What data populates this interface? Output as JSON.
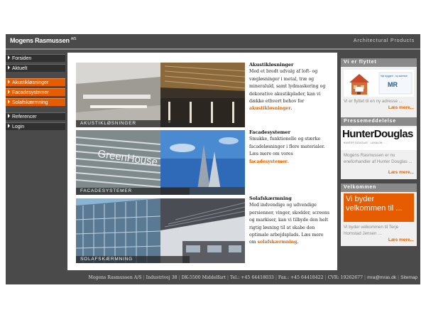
{
  "header": {
    "logo_text": "Mogens Rasmussen",
    "logo_suffix": "A/S",
    "tagline": "Architectural Products"
  },
  "nav": {
    "items": [
      {
        "label": "Forsiden",
        "style": "dark"
      },
      {
        "label": "Aktuelt",
        "style": "dark"
      },
      {
        "label": "Akustikløsninger",
        "style": "orange"
      },
      {
        "label": "Facadesystemer",
        "style": "orange"
      },
      {
        "label": "Solafskærmning",
        "style": "orange"
      },
      {
        "label": "Referencer",
        "style": "dark"
      },
      {
        "label": "Login",
        "style": "dark"
      }
    ]
  },
  "main": {
    "sections": [
      {
        "caption": "AKUSTIKLØSNINGER",
        "heading": "Akustikløsninger",
        "body": "Med et bredt udvalg af loft- og vægløsninger i metal, træ og mineraluld, samt lydmaskering og dekorative akustikplader, kan vi dække ethvert behov for",
        "link": "akustikløsninger",
        "suffix": "."
      },
      {
        "caption": "FACADESYSTEMER",
        "heading": "Facadesystemer",
        "body": "Smukke, funktionelle og stærke facadeløsninger i flere materialer.",
        "body2": "Læs mere om vores",
        "link": "facadesystemer",
        "suffix": "."
      },
      {
        "caption": "SOLAFSKÆRMNING",
        "heading": "Solafskærmning",
        "body": "Med indvendige og udvendige persienner, vinger, skodder, screens og markiser, kan vi tilbyde den helt rigtig løsning til at skabe den optimale arbejdsplads. Læs mere om",
        "link": "solafskærmning",
        "suffix": "."
      }
    ],
    "image_texts": {
      "facade_sign": "GreenHouse"
    }
  },
  "sidebar": {
    "moved": {
      "title": "Vi er flyttet",
      "text": "Vi er flyttet til en ny adresse ...",
      "more": "Læs mere...",
      "image_text": "Nyt byggeri - ny adresse",
      "image_logo": "MR"
    },
    "press": {
      "title": "Pressemeddelelse",
      "logo": "HunterDouglas",
      "logo_sub": "HUNTER DOUGLAS · LUXALON · ...",
      "text": "Mogens Rasmussen er nu eneforhandler af Hunter Douglas ...",
      "more": "Læs mere..."
    },
    "welcome": {
      "title": "Velkommen",
      "banner": "Vi byder velkommen til ...",
      "text": "Vi byder velkommen til Terje Homstad Jensen ...",
      "more": "Læs mere..."
    }
  },
  "footer": {
    "company": "Mogens Rasmussen A/S",
    "address": "Industrivej 38",
    "city": "DK-5500 Middelfart",
    "phone": "Tel.: +45 64418033",
    "fax": "Fax.: +45 64418422",
    "cvr": "CVR: 19262677",
    "email": "mra@mras.dk",
    "sitemap": "Sitemap"
  },
  "colors": {
    "accent": "#e65c00",
    "frame": "#4a4a4a",
    "nav_dark": "#303030",
    "sidebar_header": "#8a8a8a"
  }
}
